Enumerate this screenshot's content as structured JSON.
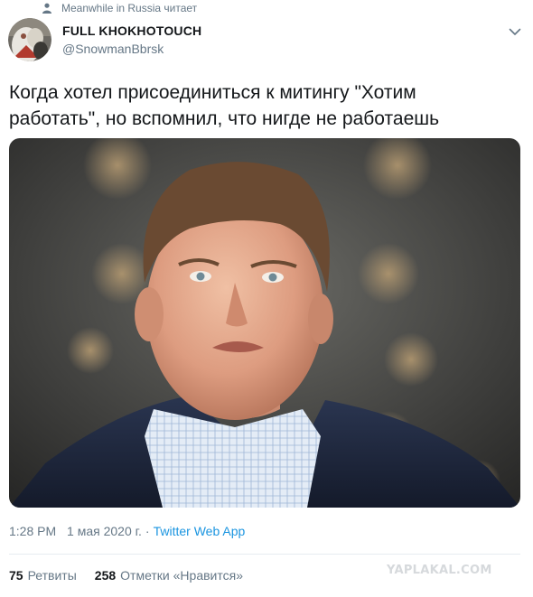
{
  "social_context": {
    "text": "Meanwhile in Russia читает",
    "icon": "user-icon"
  },
  "author": {
    "name": "FULL KHOKHOTOUCH",
    "handle": "@SnowmanBbrsk",
    "avatar_icon": "avatar",
    "menu_icon": "chevron-down-icon"
  },
  "tweet": {
    "text": "Когда хотел присоединиться к митингу \"Хотим\nработать\", но вспомнил, что нигде не работаешь"
  },
  "media": {
    "icon": "photo"
  },
  "meta": {
    "time": "1:28 PM",
    "separator": "·",
    "date": "1 мая 2020 г.",
    "source": "Twitter Web App"
  },
  "stats": {
    "retweets_count": "75",
    "retweets_label": "Ретвиты",
    "likes_count": "258",
    "likes_label": "Отметки «Нравится»"
  },
  "watermark": {
    "text": "YAPLAKAL.COM"
  },
  "colors": {
    "text": "#14171a",
    "secondary": "#657786",
    "link": "#1b95e0",
    "divider": "#e6ecf0",
    "watermark": "#d6d9dc"
  }
}
